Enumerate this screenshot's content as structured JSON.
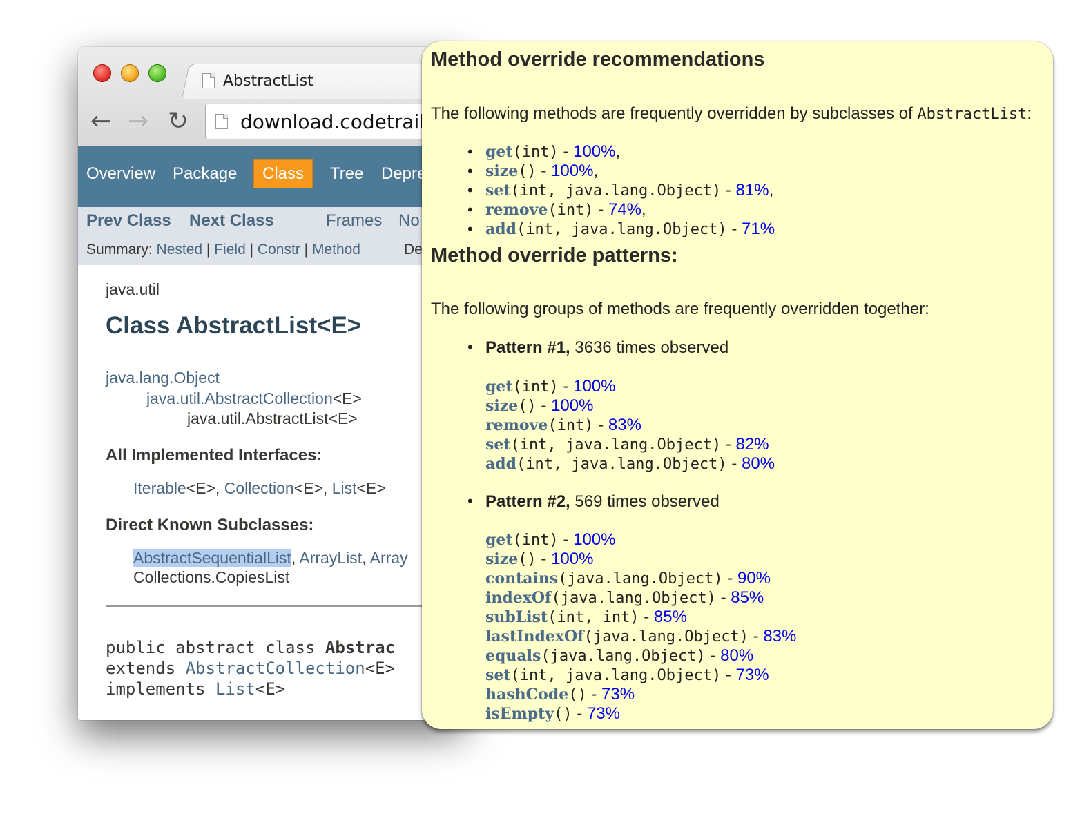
{
  "browser": {
    "tab_title": "AbstractList",
    "url": "download.codetrails",
    "back_icon": "←",
    "forward_icon": "→",
    "reload_icon": "↻"
  },
  "javadoc": {
    "topnav": [
      "Overview",
      "Package",
      "Class",
      "Tree",
      "Depre"
    ],
    "active_index": 2,
    "subnav": {
      "prev_class": "Prev Class",
      "next_class": "Next Class",
      "frames": "Frames",
      "no_frames": "No",
      "summary_label": "Summary:",
      "summary_links": [
        "Nested",
        "Field",
        "Constr",
        "Method"
      ],
      "sep": "|",
      "detail": "De"
    },
    "package": "java.util",
    "class_title": "Class AbstractList<E>",
    "inheritance": [
      {
        "text": "java.lang.Object",
        "link": true
      },
      {
        "text": "java.util.AbstractCollection",
        "suffix": "<E>",
        "link": true
      },
      {
        "text": "java.util.AbstractList<E>",
        "link": false
      }
    ],
    "interfaces_heading": "All Implemented Interfaces:",
    "interfaces": [
      {
        "name": "Iterable",
        "suffix": "<E>, "
      },
      {
        "name": "Collection",
        "suffix": "<E>, "
      },
      {
        "name": "List",
        "suffix": "<E>"
      }
    ],
    "subclasses_heading": "Direct Known Subclasses:",
    "subclasses_line1": [
      {
        "name": "AbstractSequentialList",
        "suffix": ", ",
        "selected": true
      },
      {
        "name": "ArrayList",
        "suffix": ", "
      },
      {
        "name": "Array",
        "suffix": ""
      }
    ],
    "subclasses_line2": "Collections.CopiesList",
    "signature": {
      "line1_pre": "public abstract class ",
      "line1_bold": "Abstrac",
      "line2_pre": "extends ",
      "line2_link": "AbstractCollection",
      "line2_post": "<E>",
      "line3_pre": "implements ",
      "line3_link": "List",
      "line3_post": "<E>"
    }
  },
  "popup": {
    "heading1": "Method override recommendations",
    "intro1_pre": "The following methods are frequently overridden by subclasses of ",
    "intro1_code": "AbstractList",
    "intro1_post": ":",
    "recommendations": [
      {
        "name": "get",
        "args": "(int)",
        "sep": " - ",
        "pct": "100%",
        "trail": ","
      },
      {
        "name": "size",
        "args": "()",
        "sep": " - ",
        "pct": "100%",
        "trail": ","
      },
      {
        "name": "set",
        "args": "(int, java.lang.Object)",
        "sep": " - ",
        "pct": "81%",
        "trail": ","
      },
      {
        "name": "remove",
        "args": "(int)",
        "sep": " - ",
        "pct": "74%",
        "trail": ","
      },
      {
        "name": "add",
        "args": "(int, java.lang.Object)",
        "sep": " - ",
        "pct": "71%",
        "trail": ""
      }
    ],
    "heading2": "Method override patterns:",
    "intro2": "The following groups of methods are frequently overridden together:",
    "patterns": [
      {
        "title": "Pattern #1,",
        "observed": " 3636 times observed",
        "methods": [
          {
            "name": "get",
            "args": "(int)",
            "sep": " - ",
            "pct": "100%"
          },
          {
            "name": "size",
            "args": "()",
            "sep": " - ",
            "pct": "100%"
          },
          {
            "name": "remove",
            "args": "(int)",
            "sep": " - ",
            "pct": "83%"
          },
          {
            "name": "set",
            "args": "(int, java.lang.Object)",
            "sep": " - ",
            "pct": "82%"
          },
          {
            "name": "add",
            "args": "(int, java.lang.Object)",
            "sep": " - ",
            "pct": "80%"
          }
        ]
      },
      {
        "title": "Pattern #2,",
        "observed": " 569 times observed",
        "methods": [
          {
            "name": "get",
            "args": "(int)",
            "sep": " - ",
            "pct": "100%"
          },
          {
            "name": "size",
            "args": "()",
            "sep": " - ",
            "pct": "100%"
          },
          {
            "name": "contains",
            "args": "(java.lang.Object)",
            "sep": " - ",
            "pct": "90%"
          },
          {
            "name": "indexOf",
            "args": "(java.lang.Object)",
            "sep": " - ",
            "pct": "85%"
          },
          {
            "name": "subList",
            "args": "(int, int)",
            "sep": " - ",
            "pct": "85%"
          },
          {
            "name": "lastIndexOf",
            "args": "(java.lang.Object)",
            "sep": " - ",
            "pct": "83%"
          },
          {
            "name": "equals",
            "args": "(java.lang.Object)",
            "sep": " - ",
            "pct": "80%"
          },
          {
            "name": "set",
            "args": "(int, java.lang.Object)",
            "sep": " - ",
            "pct": "73%"
          },
          {
            "name": "hashCode",
            "args": "()",
            "sep": " - ",
            "pct": "73%"
          },
          {
            "name": "isEmpty",
            "args": "()",
            "sep": " - ",
            "pct": "73%"
          }
        ]
      }
    ]
  }
}
